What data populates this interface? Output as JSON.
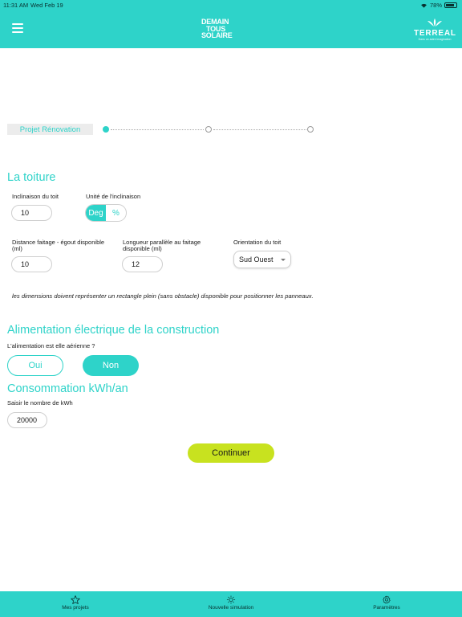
{
  "status_bar": {
    "time": "11:31 AM",
    "date": "Wed Feb 19",
    "battery": "78%"
  },
  "header": {
    "brand_line1": "DEMAIN",
    "brand_line2": "TOUS",
    "brand_line3": "SOLAIRE",
    "partner_name": "TERREAL",
    "partner_tagline": "Dans un autre imagination"
  },
  "stepper": {
    "current_step_label": "Projet Rénovation",
    "steps_total": 3,
    "active_step": 1
  },
  "toiture": {
    "title": "La toiture",
    "inclinaison_label": "Inclinaison du toit",
    "inclinaison_value": "10",
    "unite_label": "Unité de l'inclinaison",
    "unit_options": [
      "Deg",
      "%"
    ],
    "unit_selected": "Deg",
    "distance_label": "Distance faitage - égout disponible (ml)",
    "distance_value": "10",
    "longueur_label": "Longueur parallèle au faitage disponible (ml)",
    "longueur_value": "12",
    "orientation_label": "Orientation du toit",
    "orientation_value": "Sud Ouest",
    "note": "les dimensions doivent représenter un rectangle plein (sans obstacle) disponible pour positionner les panneaux."
  },
  "alimentation": {
    "title": "Alimentation électrique de la construction",
    "question": "L'alimentation est elle aérienne ?",
    "option_yes": "Oui",
    "option_no": "Non",
    "selected": "Non"
  },
  "consommation": {
    "title": "Consommation kWh/an",
    "label": "Saisir le nombre de kWh",
    "value": "20000"
  },
  "continue_label": "Continuer",
  "tabs": [
    {
      "label": "Mes projets",
      "icon": "star-icon"
    },
    {
      "label": "Nouvelle simulation",
      "icon": "sun-icon"
    },
    {
      "label": "Paramètres",
      "icon": "gear-icon"
    }
  ],
  "colors": {
    "accent": "#2ed3c9",
    "button": "#c8e21f"
  }
}
